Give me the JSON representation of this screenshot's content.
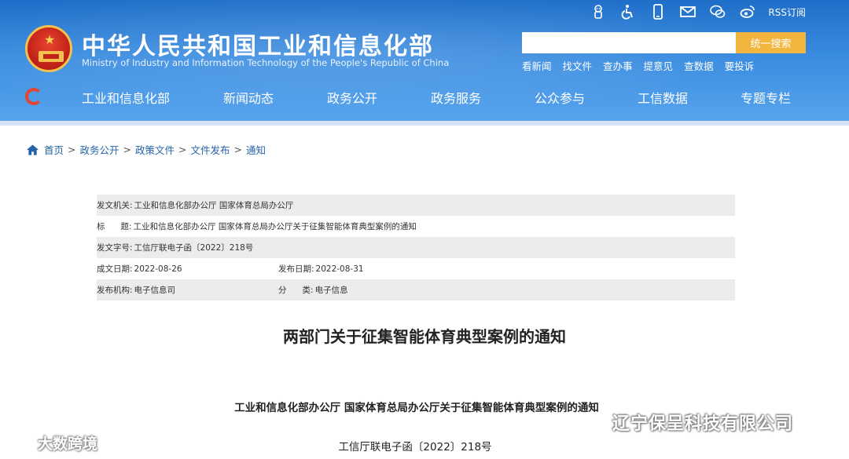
{
  "header": {
    "ministry_name_cn": "中华人民共和国工业和信息化部",
    "ministry_name_en": "Ministry of Industry and Information Technology of the People's Republic of China",
    "top_icons": [
      "robot-icon",
      "accessibility-icon",
      "mobile-icon",
      "mail-icon",
      "wechat-icon",
      "weibo-icon"
    ],
    "rss_label": "RSS订阅",
    "search": {
      "placeholder": "",
      "button_label": "统一搜索"
    },
    "quick_links": [
      "看新闻",
      "找文件",
      "查办事",
      "提意见",
      "查数据",
      "要投诉"
    ],
    "nav": [
      "工业和信息化部",
      "新闻动态",
      "政务公开",
      "政务服务",
      "公众参与",
      "工信数据",
      "专题专栏"
    ]
  },
  "breadcrumb": [
    "首页",
    "政务公开",
    "政策文件",
    "文件发布",
    "通知"
  ],
  "breadcrumb_sep": ">",
  "info": {
    "issuer": {
      "label": "发文机关:",
      "value": "工业和信息化部办公厅 国家体育总局办公厅"
    },
    "title": {
      "label": "标      题:",
      "value": "工业和信息化部办公厅 国家体育总局办公厅关于征集智能体育典型案例的通知"
    },
    "doc_number": {
      "label": "发文字号:",
      "value": "工信厅联电子函〔2022〕218号"
    },
    "created_date": {
      "label": "成文日期:",
      "value": "2022-08-26"
    },
    "publish_date": {
      "label": "发布日期:",
      "value": "2022-08-31"
    },
    "publisher": {
      "label": "发布机构:",
      "value": "电子信息司"
    },
    "category": {
      "label": "分      类:",
      "value": "电子信息"
    }
  },
  "article": {
    "title": "两部门关于征集智能体育典型案例的通知",
    "subtitle": "工业和信息化部办公厅 国家体育总局办公厅关于征集智能体育典型案例的通知",
    "doc_number": "工信厅联电子函〔2022〕218号"
  },
  "watermarks": {
    "left": "大数跨境",
    "right": "辽宁保呈科技有限公司"
  },
  "colors": {
    "header_blue": "#2a7bd6",
    "search_button": "#f2b53d",
    "link_blue": "#2563a9",
    "row_shade": "#ececec"
  }
}
